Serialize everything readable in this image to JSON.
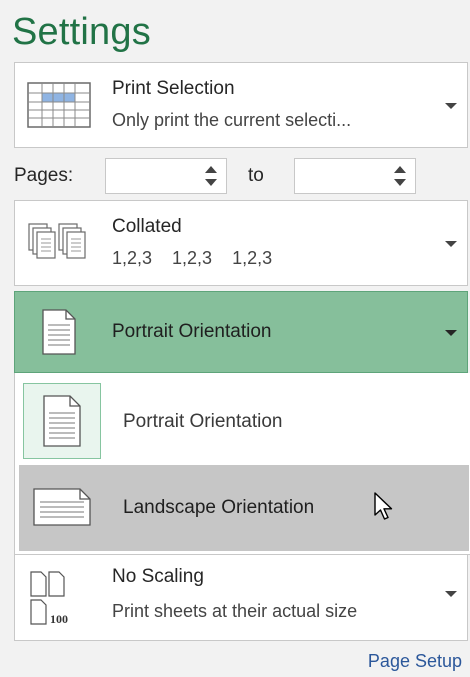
{
  "settings": {
    "title": "Settings"
  },
  "print_what": {
    "title": "Print Selection",
    "subtitle": "Only print the current selecti..."
  },
  "pages": {
    "label": "Pages:",
    "from_value": "",
    "to_label": "to",
    "to_value": ""
  },
  "collation": {
    "title": "Collated",
    "subtitle": "1,2,3    1,2,3    1,2,3"
  },
  "orientation": {
    "selected": "Portrait Orientation",
    "options": [
      {
        "label": "Portrait Orientation"
      },
      {
        "label": "Landscape Orientation"
      }
    ]
  },
  "scaling": {
    "title": "No Scaling",
    "subtitle": "Print sheets at their actual size",
    "icon_text": "100"
  },
  "page_setup": {
    "label": "Page Setup"
  },
  "colors": {
    "accent": "#217346",
    "selected_bg": "#86bf9b",
    "hover_bg": "#c6c6c6",
    "link": "#2b579a"
  }
}
